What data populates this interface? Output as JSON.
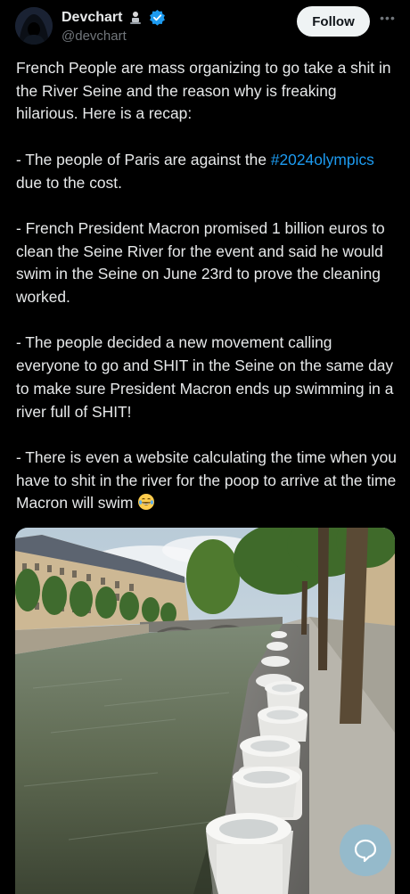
{
  "author": {
    "display_name": "Devchart",
    "handle": "@devchart",
    "verified": true
  },
  "actions": {
    "follow_label": "Follow",
    "more_icon": "more-horizontal-icon"
  },
  "post": {
    "paragraphs": [
      {
        "text": "French People are mass organizing to go take a shit in the River Seine and the reason why is freaking hilarious. Here is a recap:"
      },
      {
        "before": "- The people of Paris are against the ",
        "hashtag": "#2024olympics",
        "after": " due to the cost."
      },
      {
        "text": "- French President Macron promised 1 billion euros to clean the Seine River for the event and said he would swim in the Seine on June 23rd to prove the cleaning worked."
      },
      {
        "text": "- The people decided a new movement calling everyone to go and SHIT in the Seine on the same day to make sure President Macron ends up swimming in a river full of SHIT!"
      },
      {
        "text": "- There is even a website calculating the time when you have to shit in the river for the poop to arrive at the time Macron will swim"
      }
    ],
    "emoji": "laughing-with-tears-emoji"
  },
  "colors": {
    "background": "#000000",
    "text": "#e7e9ea",
    "secondary_text": "#71767b",
    "link": "#1d9bf0",
    "verified": "#1d9bf0"
  }
}
